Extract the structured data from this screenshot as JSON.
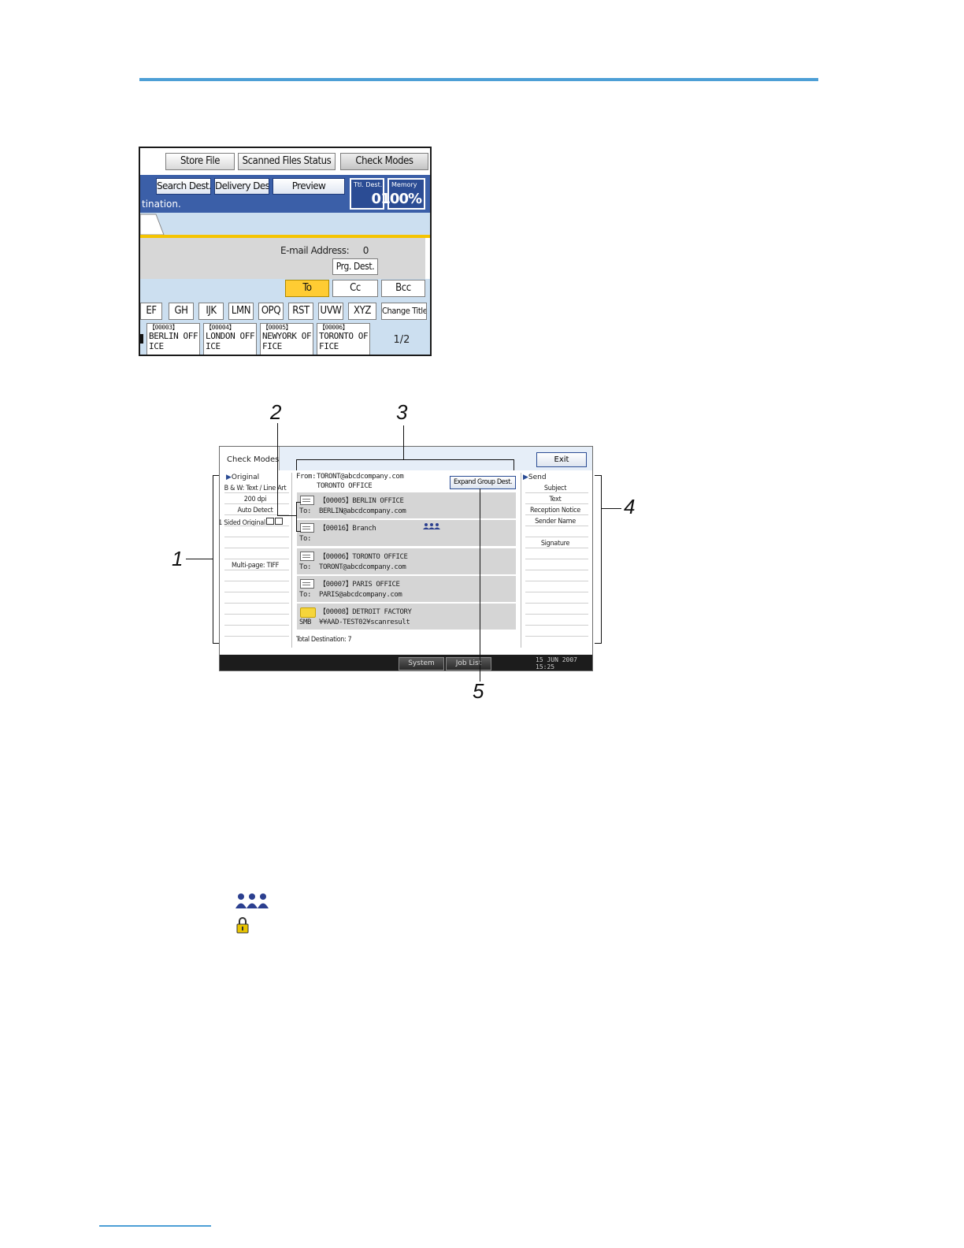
{
  "screen1": {
    "top_buttons": [
      "Store File",
      "Scanned Files Status",
      "Check Modes"
    ],
    "blue_buttons": [
      "Search Dest.",
      "Delivery Dest.",
      "Preview"
    ],
    "message": "tination.",
    "counter_total": {
      "label": "Ttl. Dest.",
      "value": "0"
    },
    "counter_memory": {
      "label": "Memory",
      "value": "100%"
    },
    "email_address_label": "E-mail Address:",
    "email_address_count": "0",
    "prg_dest": "Prg. Dest.",
    "to": "To",
    "cc": "Cc",
    "bcc": "Bcc",
    "index_buttons": [
      "EF",
      "GH",
      "IJK",
      "LMN",
      "OPQ",
      "RST",
      "UVW",
      "XYZ"
    ],
    "change_title": "Change Title",
    "dest_cards": [
      {
        "code": "【00003】",
        "name": "BERLIN OFF\nICE"
      },
      {
        "code": "【00004】",
        "name": "LONDON OFF\nICE"
      },
      {
        "code": "【00005】",
        "name": "NEWYORK OF\nFICE"
      },
      {
        "code": "【00006】",
        "name": "TORONTO OF\nFICE"
      }
    ],
    "page": "1/2"
  },
  "screen2": {
    "title": "Check Modes",
    "exit": "Exit",
    "left_header": "Original",
    "left_items": [
      "B & W: Text / Line Art",
      "200 dpi",
      "Auto Detect",
      "1 Sided Original",
      "",
      "",
      "",
      "Multi-page: TIFF"
    ],
    "from_label": "From:",
    "from_email": "TORONT@abcdcompany.com",
    "from_name": "TORONTO OFFICE",
    "expand_group": "Expand Group Dest.",
    "destinations": [
      {
        "name": "【00005】BERLIN OFFICE",
        "prefix": "To:",
        "address": "BERLIN@abcdcompany.com"
      },
      {
        "name": "【00016】Branch",
        "prefix": "To:",
        "address": ""
      },
      {
        "name": "【00006】TORONTO OFFICE",
        "prefix": "To:",
        "address": "TORONT@abcdcompany.com"
      },
      {
        "name": "【00007】PARIS OFFICE",
        "prefix": "To:",
        "address": "PARIS@abcdcompany.com"
      },
      {
        "name": "【00008】DETROIT FACTORY",
        "prefix": "SMB",
        "address": "¥¥AAD-TEST02¥scanresult"
      }
    ],
    "total_destination": "Total Destination: 7",
    "right_header": "Send",
    "right_items": [
      "Subject",
      "Text",
      "Reception Notice",
      "Sender Name",
      "",
      "Signature"
    ],
    "system_status": "System Status",
    "job_list": "Job List",
    "date": "15 JUN  2007",
    "time": "15:25"
  },
  "callouts": [
    "1",
    "2",
    "3",
    "4",
    "5"
  ],
  "legend_icons": [
    "group-icon",
    "lock-icon"
  ],
  "colors": {
    "rule": "#4d9fd6",
    "blue_bar": "#3b5fa8",
    "highlight_to": "#ffcc33",
    "group_icon": "#2b3f8f",
    "lock_icon": "#e8c400"
  }
}
